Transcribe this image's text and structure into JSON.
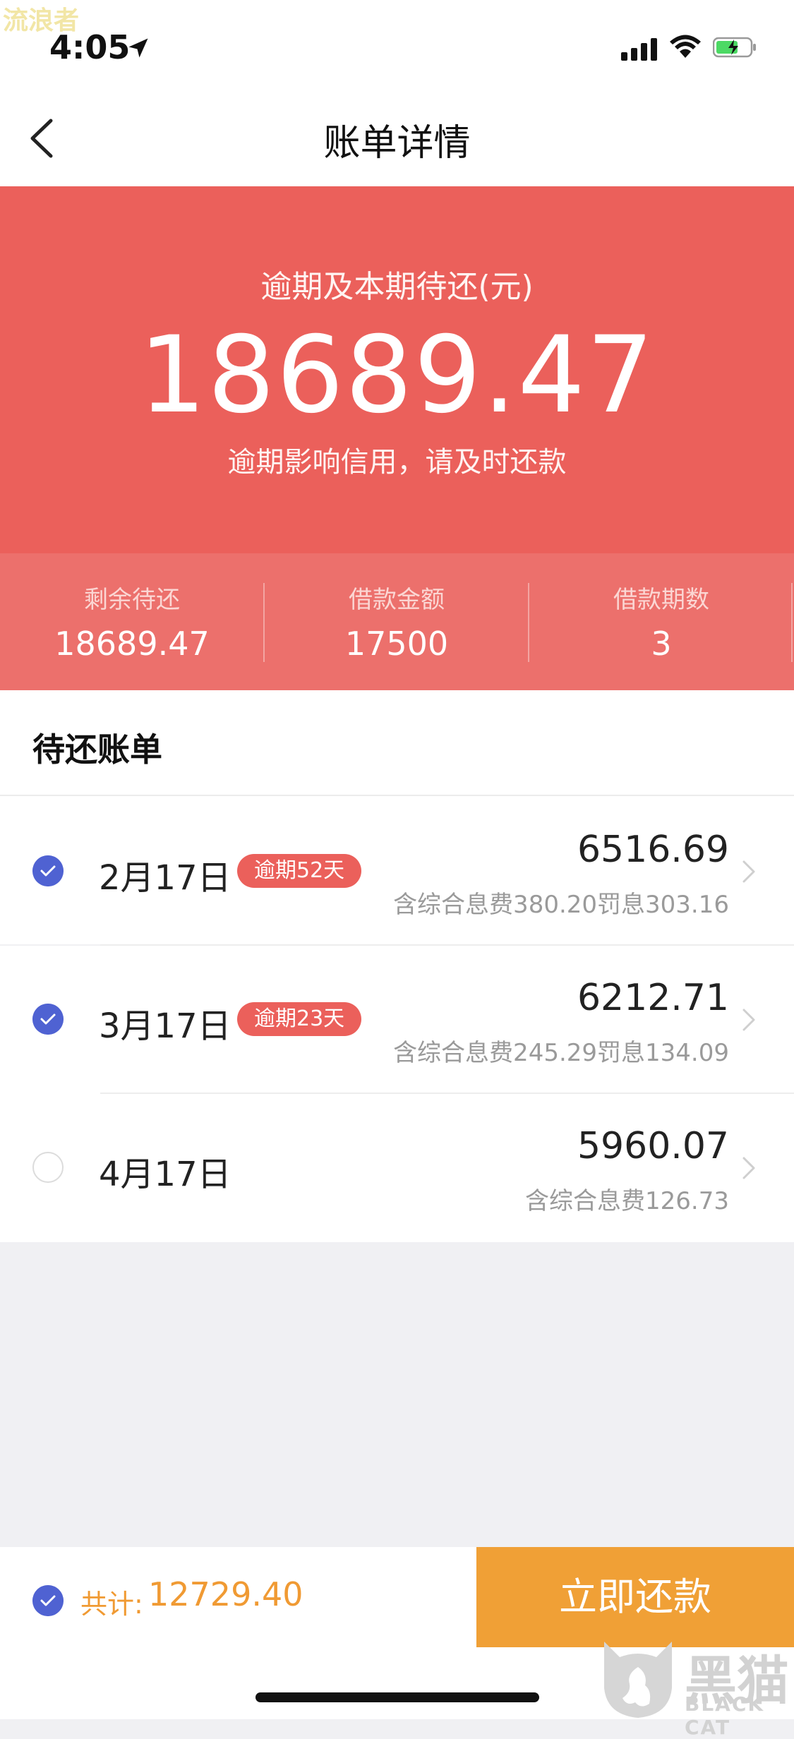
{
  "watermark": "流浪者",
  "status": {
    "time": "4:05"
  },
  "header": {
    "title": "账单详情"
  },
  "hero": {
    "label": "逾期及本期待还(元)",
    "amount": "18689.47",
    "warning": "逾期影响信用，请及时还款"
  },
  "stats": [
    {
      "label": "剩余待还",
      "value": "18689.47"
    },
    {
      "label": "借款金额",
      "value": "17500"
    },
    {
      "label": "借款期数",
      "value": "3"
    }
  ],
  "section": {
    "title": "待还账单"
  },
  "bills": [
    {
      "date": "2月17日",
      "badge": "逾期52天",
      "amount": "6516.69",
      "detail": "含综合息费380.20罚息303.16",
      "checked": true
    },
    {
      "date": "3月17日",
      "badge": "逾期23天",
      "amount": "6212.71",
      "detail": "含综合息费245.29罚息134.09",
      "checked": true
    },
    {
      "date": "4月17日",
      "badge": "",
      "amount": "5960.07",
      "detail": "含综合息费126.73",
      "checked": false
    }
  ],
  "footer": {
    "total_label": "共计:",
    "total_value": "12729.40",
    "pay_label": "立即还款"
  },
  "corner_logo": {
    "cn": "黑猫",
    "en": "BLACK CAT"
  },
  "colors": {
    "accent_red": "#eb605b",
    "accent_orange": "#f0a036",
    "check_blue": "#4f62d2"
  }
}
